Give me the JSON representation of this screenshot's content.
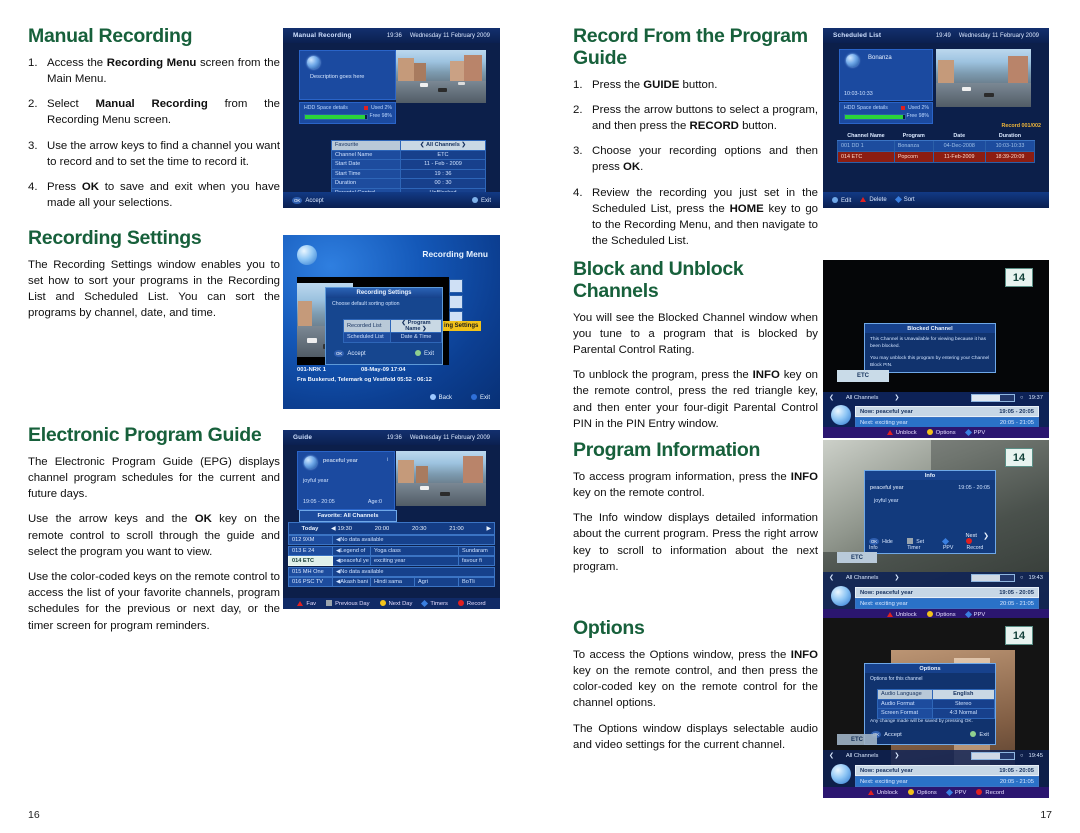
{
  "page": {
    "left_number": "16",
    "right_number": "17"
  },
  "sections": {
    "manual_recording": {
      "title": "Manual Recording",
      "steps": [
        {
          "num": "1.",
          "html": "Access the <b>Recording Menu</b> screen from the Main Menu."
        },
        {
          "num": "2.",
          "html": "Select <b>Manual Recording</b> from the Recording Menu screen."
        },
        {
          "num": "3.",
          "html": "Use the arrow keys to find a channel you want to record and to set the time to record it."
        },
        {
          "num": "4.",
          "html": "Press <b>OK</b> to save and exit when you have made all your selections."
        }
      ]
    },
    "recording_settings": {
      "title": "Recording Settings",
      "paragraphs": [
        "The Recording Settings window enables you to set how to sort your programs in the Recording List and Scheduled List. You can sort the programs by channel, date, and time."
      ]
    },
    "electronic_program_guide": {
      "title": "Electronic Program Guide",
      "paragraphs_html": [
        "The Electronic Program Guide (EPG) displays channel program schedules for the current and future days.",
        "Use the arrow keys and the <b>OK</b> key on the remote control to scroll through the guide and select the program you want to view.",
        "Use the color-coded keys on the remote control to access the list of your favorite channels, program schedules for the previous or next day, or the timer screen for program reminders."
      ]
    },
    "record_from_guide": {
      "title": "Record From the Program Guide",
      "steps": [
        {
          "num": "1.",
          "html": "Press the <b>GUIDE</b> button."
        },
        {
          "num": "2.",
          "html": "Press the arrow buttons to select a program, and then press the <b>RECORD</b> button."
        },
        {
          "num": "3.",
          "html": "Choose your recording options and then press <b>OK</b>."
        },
        {
          "num": "4.",
          "html": "Review the recording you just set in the Scheduled List, press the <b>HOME</b> key to go to the Recording Menu, and then navigate to the Scheduled List."
        }
      ]
    },
    "block_unblock": {
      "title": "Block and Unblock Channels",
      "paragraphs_html": [
        "You will see the Blocked Channel window when you tune to a program that is blocked by Parental Control Rating.",
        "To unblock the program, press the <b>INFO</b> key on the remote control, press the red triangle key, and then enter your four-digit Parental Control PIN in the PIN Entry window."
      ]
    },
    "program_information": {
      "title": "Program Information",
      "paragraphs_html": [
        "To access program information, press the <b>INFO</b> key on the remote control.",
        "The Info window displays detailed information about the current program. Press the right arrow key to scroll to information about the next program."
      ]
    },
    "options": {
      "title": "Options",
      "paragraphs_html": [
        "To access the Options window, press the <b>INFO</b> key on the remote control, and then press the color-coded key on the remote control for the channel options.",
        "The Options window displays selectable audio and video settings for the current channel."
      ]
    }
  },
  "screenshots": {
    "manual_recording": {
      "header_title": "Manual Recording",
      "header_time": "19:36",
      "header_date": "Wednesday 11 February 2009",
      "description": "Description goes here",
      "hdd_label": "HDD Space details",
      "hdd_used": "Used 2%",
      "hdd_free": "Free 98%",
      "form": [
        {
          "key": "Favourite",
          "value": "All Channels",
          "selected": true
        },
        {
          "key": "Channel Name",
          "value": "ETC",
          "selected": false
        },
        {
          "key": "Start Date",
          "value": "11 - Feb - 2009",
          "selected": false
        },
        {
          "key": "Start Time",
          "value": "19 : 36",
          "selected": false
        },
        {
          "key": "Duration",
          "value": "00 : 30",
          "selected": false
        },
        {
          "key": "Parental Control",
          "value": "UnBlocked",
          "selected": false
        }
      ],
      "footer": [
        {
          "glyph": "OK",
          "label": "Accept"
        },
        {
          "glyph": "dot",
          "label": "Exit"
        }
      ]
    },
    "recording_menu": {
      "menu_title": "Recording Menu",
      "highlight_item": "ing Settings",
      "dialog_title": "Recording Settings",
      "dialog_subtitle": "Choose default sorting option",
      "rows": [
        {
          "key": "Recorded List",
          "value": "Program Name",
          "selected": true
        },
        {
          "key": "Scheduled List",
          "value": "Date & Time",
          "selected": false
        }
      ],
      "accept": "Accept",
      "exit": "Exit",
      "banner_channel": "001-NRK 1",
      "banner_date": "08-May-09 17:04",
      "banner_desc": "Fra Buskerud, Telemark og Vestfold 05:52 - 06:12",
      "back": "Back",
      "exit2": "Exit"
    },
    "guide": {
      "header_title": "Guide",
      "header_time": "19:36",
      "header_date": "Wednesday 11 February 2009",
      "program_now": "peaceful year",
      "program_sub": "joyful year",
      "program_time": "19:05 - 20:05",
      "program_age": "Age:0",
      "favorite": "Favorite: All Channels",
      "day_label": "Today",
      "time_slots": [
        "19:30",
        "20:00",
        "20:30",
        "21:00"
      ],
      "rows": [
        {
          "channel": "012 9XM",
          "programs": [
            "No data available"
          ],
          "selected": false
        },
        {
          "channel": "013 E 24",
          "programs": [
            "Legend of",
            "Yoga class",
            "Sundaram"
          ],
          "selected": false
        },
        {
          "channel": "014 ETC",
          "programs": [
            "peaceful ye",
            "exciting year",
            "favour fi"
          ],
          "selected": true
        },
        {
          "channel": "015 MH One",
          "programs": [
            "No data available"
          ],
          "selected": false
        },
        {
          "channel": "016 PSC TV",
          "programs": [
            "Akash bani",
            "Hindi sama",
            "Agri",
            "BoTli"
          ],
          "selected": false
        }
      ],
      "colorkeys": [
        {
          "shape": "tri",
          "color": "#e02020",
          "label": "Fav"
        },
        {
          "shape": "sq",
          "color": "#9aa4ad",
          "label": "Previous Day"
        },
        {
          "shape": "dot",
          "color": "#f2c21a",
          "label": "Next Day"
        },
        {
          "shape": "dia",
          "color": "#3a7fe0",
          "label": "Timers"
        },
        {
          "shape": "dot",
          "color": "#e02020",
          "label": "Record"
        }
      ]
    },
    "scheduled_list": {
      "header_title": "Scheduled List",
      "header_time": "19:49",
      "header_date": "Wednesday 11 February 2009",
      "program_name": "Bonanza",
      "program_time": "10:03-10:33",
      "hdd_label": "HDD Space details",
      "hdd_used": "Used 2%",
      "hdd_free": "Free 98%",
      "record_count": "Record 001/002",
      "columns": [
        "Channel Name",
        "Program",
        "Date",
        "Duration"
      ],
      "rows": [
        {
          "channel": "001 DD 1",
          "program": "Bonanza",
          "date": "04-Dec-2008",
          "duration": "10:03-10:33",
          "selected": false
        },
        {
          "channel": "014 ETC",
          "program": "Popcorn",
          "date": "11-Feb-2009",
          "duration": "18:39-20:09",
          "selected": true
        }
      ],
      "footer": [
        {
          "shape": "dot",
          "color": "#6fa8e8",
          "label": "Edit"
        },
        {
          "shape": "tri",
          "color": "#e02020",
          "label": "Delete"
        },
        {
          "shape": "dia",
          "color": "#3a7fe0",
          "label": "Sort"
        }
      ]
    },
    "blocked_channel": {
      "badge": "14",
      "dialog_title": "Blocked Channel",
      "line1": "This Channel is Unavailable for viewing because it has been blocked.",
      "line2": "You may unblock this program by entering your Channel Block PIN.",
      "channel_tag": "ETC",
      "channel_list": "All Channels",
      "clock": "19:37",
      "now_label": "Now: peaceful year",
      "now_time": "19:05 - 20:05",
      "next_label": "Next: exciting year",
      "next_time": "20:05 - 21:05",
      "colorkeys": [
        {
          "shape": "tri",
          "color": "#e02020",
          "label": "Unblock"
        },
        {
          "shape": "dot",
          "color": "#f2c21a",
          "label": "Options"
        },
        {
          "shape": "dia",
          "color": "#3a7fe0",
          "label": "PPV"
        }
      ]
    },
    "info_window": {
      "badge": "14",
      "dialog_title": "Info",
      "program": "peaceful year",
      "program_time": "19:05 - 20:05",
      "program_sub": "joyful year",
      "next_label": "Next",
      "buttons": [
        {
          "glyph": "OK",
          "label": "Hide Info"
        },
        {
          "shape": "sq",
          "color": "#9aa4ad",
          "label": "Set Timer"
        },
        {
          "shape": "dia",
          "color": "#3a7fe0",
          "label": "PPV"
        },
        {
          "shape": "dot",
          "color": "#e02020",
          "label": "Record"
        }
      ],
      "channel_tag": "ETC",
      "channel_list": "All Channels",
      "clock": "19:43",
      "now_label": "Now: peaceful year",
      "now_time": "19:05 - 20:05",
      "next_row_label": "Next: exciting year",
      "next_row_time": "20:05 - 21:05",
      "colorkeys": [
        {
          "shape": "tri",
          "color": "#e02020",
          "label": "Unblock"
        },
        {
          "shape": "dot",
          "color": "#f2c21a",
          "label": "Options"
        },
        {
          "shape": "dia",
          "color": "#3a7fe0",
          "label": "PPV"
        }
      ]
    },
    "options_window": {
      "badge": "14",
      "dialog_title": "Options",
      "subtitle": "Options for this channel",
      "rows": [
        {
          "key": "Audio Language",
          "value": "English",
          "selected": true
        },
        {
          "key": "Audio Format",
          "value": "Stereo",
          "selected": false
        },
        {
          "key": "Screen Format",
          "value": "4:3 Normal",
          "selected": false
        }
      ],
      "note": "Any change made will be saved by pressing OK.",
      "accept": "Accept",
      "exit": "Exit",
      "channel_tag": "ETC",
      "channel_list": "All Channels",
      "clock": "19:45",
      "now_label": "Now: peaceful year",
      "now_time": "19:05 - 20:05",
      "next_label": "Next: exciting year",
      "next_time": "20:05 - 21:05",
      "colorkeys": [
        {
          "shape": "tri",
          "color": "#e02020",
          "label": "Unblock"
        },
        {
          "shape": "dot",
          "color": "#f2c21a",
          "label": "Options"
        },
        {
          "shape": "dia",
          "color": "#3a7fe0",
          "label": "PPV"
        },
        {
          "shape": "dot",
          "color": "#e02020",
          "label": "Record"
        }
      ]
    }
  },
  "colors": {
    "heading_green": "#17603b",
    "tv_blue": "#0c1f4a",
    "highlight_yellow": "#f2c21a"
  }
}
